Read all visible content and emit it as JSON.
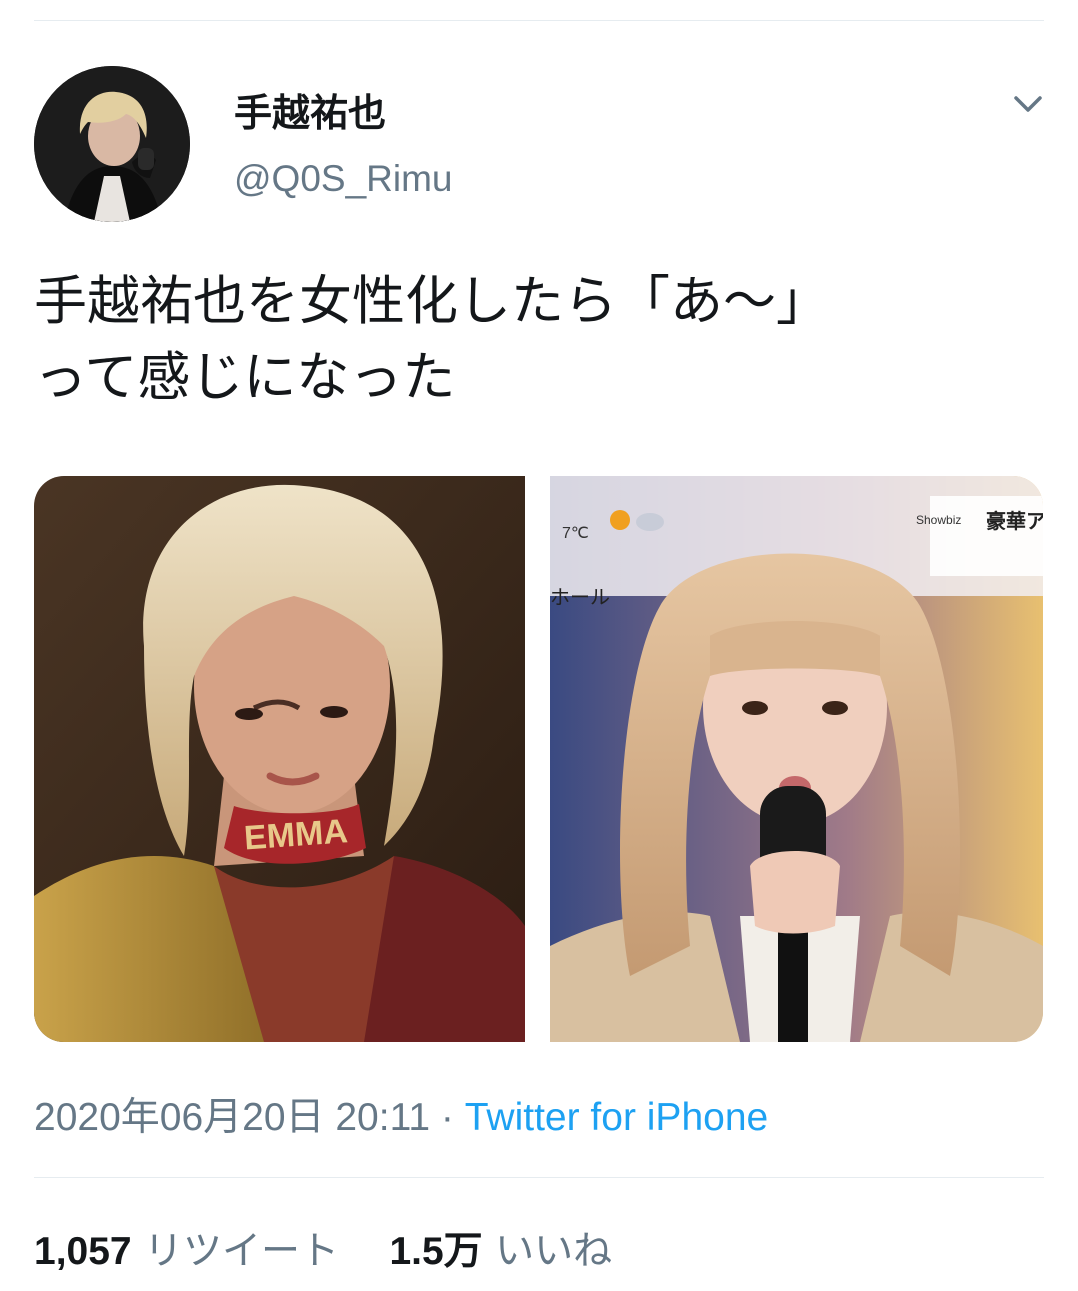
{
  "user": {
    "display_name": "手越祐也",
    "handle": "@Q0S_Rimu",
    "avatar_icon": "profile-photo"
  },
  "menu_icon": "chevron-down-icon",
  "tweet": {
    "text": "手越祐也を女性化したら「あ〜」\nって感じになった"
  },
  "media": {
    "left_caption": "EMMA",
    "right_overlay": {
      "weather_label": "7℃",
      "hall_label": "ホール",
      "showbiz_label": "Showbiz",
      "headline_label": "豪華ア"
    }
  },
  "meta": {
    "timestamp": "2020年06月20日 20:11",
    "separator": " · ",
    "source": "Twitter for iPhone"
  },
  "stats": {
    "retweets_count": "1,057",
    "retweets_label": "リツイート",
    "likes_count": "1.5万",
    "likes_label": "いいね"
  },
  "colors": {
    "text_primary": "#14171a",
    "text_secondary": "#657786",
    "link": "#1da1f2",
    "divider": "#e6ecf0"
  }
}
